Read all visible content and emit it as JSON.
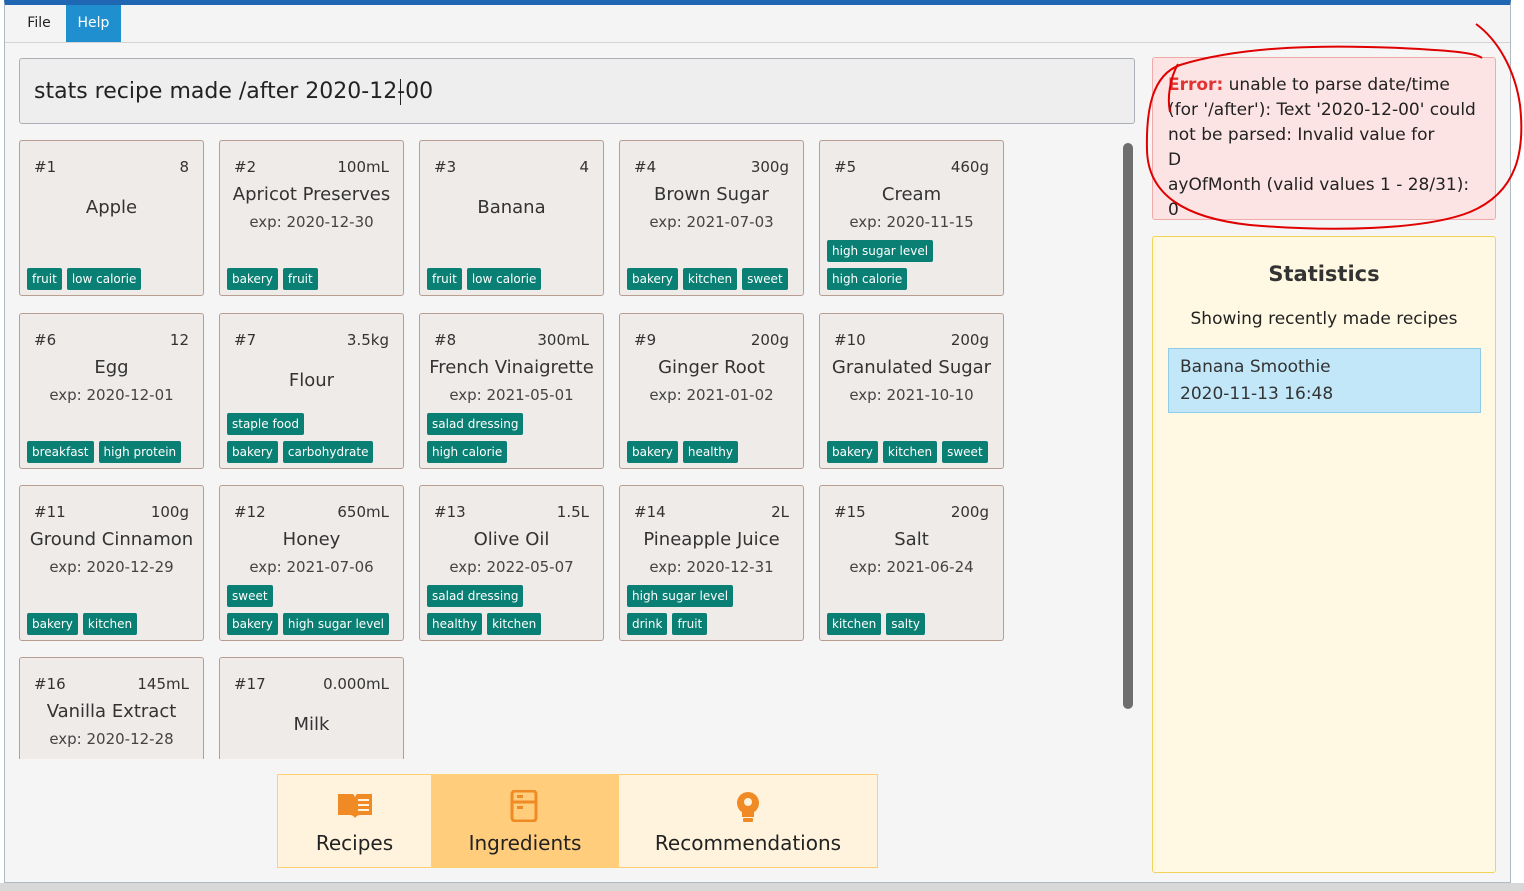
{
  "menu": {
    "file": "File",
    "help": "Help"
  },
  "command": {
    "value": "stats recipe made /after 2020-12-00"
  },
  "ingredients": [
    {
      "num": "#1",
      "qty": "8",
      "name": "Apple",
      "exp": "",
      "tags": [
        "fruit",
        "low calorie"
      ]
    },
    {
      "num": "#2",
      "qty": "100mL",
      "name": "Apricot Preserves",
      "exp": "exp: 2020-12-30",
      "tags": [
        "bakery",
        "fruit"
      ]
    },
    {
      "num": "#3",
      "qty": "4",
      "name": "Banana",
      "exp": "",
      "tags": [
        "fruit",
        "low calorie"
      ]
    },
    {
      "num": "#4",
      "qty": "300g",
      "name": "Brown Sugar",
      "exp": "exp: 2021-07-03",
      "tags": [
        "bakery",
        "kitchen",
        "sweet"
      ]
    },
    {
      "num": "#5",
      "qty": "460g",
      "name": "Cream",
      "exp": "exp: 2020-11-15",
      "tags": [
        "high calorie",
        "high sugar level"
      ]
    },
    {
      "num": "#6",
      "qty": "12",
      "name": "Egg",
      "exp": "exp: 2020-12-01",
      "tags": [
        "breakfast",
        "high protein"
      ]
    },
    {
      "num": "#7",
      "qty": "3.5kg",
      "name": "Flour",
      "exp": "",
      "tags": [
        "bakery",
        "carbohydrate",
        "staple food"
      ]
    },
    {
      "num": "#8",
      "qty": "300mL",
      "name": "French Vinaigrette",
      "exp": "exp: 2021-05-01",
      "tags": [
        "high calorie",
        "salad dressing"
      ]
    },
    {
      "num": "#9",
      "qty": "200g",
      "name": "Ginger Root",
      "exp": "exp: 2021-01-02",
      "tags": [
        "bakery",
        "healthy"
      ]
    },
    {
      "num": "#10",
      "qty": "200g",
      "name": "Granulated Sugar",
      "exp": "exp: 2021-10-10",
      "tags": [
        "bakery",
        "kitchen",
        "sweet"
      ]
    },
    {
      "num": "#11",
      "qty": "100g",
      "name": "Ground Cinnamon",
      "exp": "exp: 2020-12-29",
      "tags": [
        "bakery",
        "kitchen"
      ]
    },
    {
      "num": "#12",
      "qty": "650mL",
      "name": "Honey",
      "exp": "exp: 2021-07-06",
      "tags": [
        "bakery",
        "high sugar level",
        "sweet"
      ]
    },
    {
      "num": "#13",
      "qty": "1.5L",
      "name": "Olive Oil",
      "exp": "exp: 2022-05-07",
      "tags": [
        "healthy",
        "kitchen",
        "salad dressing"
      ]
    },
    {
      "num": "#14",
      "qty": "2L",
      "name": "Pineapple Juice",
      "exp": "exp: 2020-12-31",
      "tags": [
        "drink",
        "fruit",
        "high sugar level"
      ]
    },
    {
      "num": "#15",
      "qty": "200g",
      "name": "Salt",
      "exp": "exp: 2021-06-24",
      "tags": [
        "kitchen",
        "salty"
      ]
    },
    {
      "num": "#16",
      "qty": "145mL",
      "name": "Vanilla Extract",
      "exp": "exp: 2020-12-28",
      "tags": []
    },
    {
      "num": "#17",
      "qty": "0.000mL",
      "name": "Milk",
      "exp": "",
      "tags": []
    }
  ],
  "tabs": [
    {
      "label": "Recipes",
      "icon": "open-book-icon",
      "active": false
    },
    {
      "label": "Ingredients",
      "icon": "fridge-icon",
      "active": true
    },
    {
      "label": "Recommendations",
      "icon": "lightbulb-icon",
      "active": false
    }
  ],
  "error": {
    "prefix": "Error:",
    "message": " unable to parse date/time (for '/after'): Text '2020-12-00' could not be parsed: Invalid value for",
    "line_d": "D",
    "line_rest": "ayOfMonth (valid values 1 - 28/31): 0"
  },
  "stats": {
    "title": "Statistics",
    "subtitle": "Showing recently made recipes",
    "entry_name": "Banana Smoothie",
    "entry_time": "2020-11-13 16:48"
  },
  "colors": {
    "tag": "#0a7f73",
    "card_bg": "#efebe9",
    "card_border": "#b79e91",
    "active_tab": "#ffcd7c",
    "error_bg": "#fde4e4",
    "stats_bg": "#fff9e3",
    "annotation": "#e00000"
  }
}
